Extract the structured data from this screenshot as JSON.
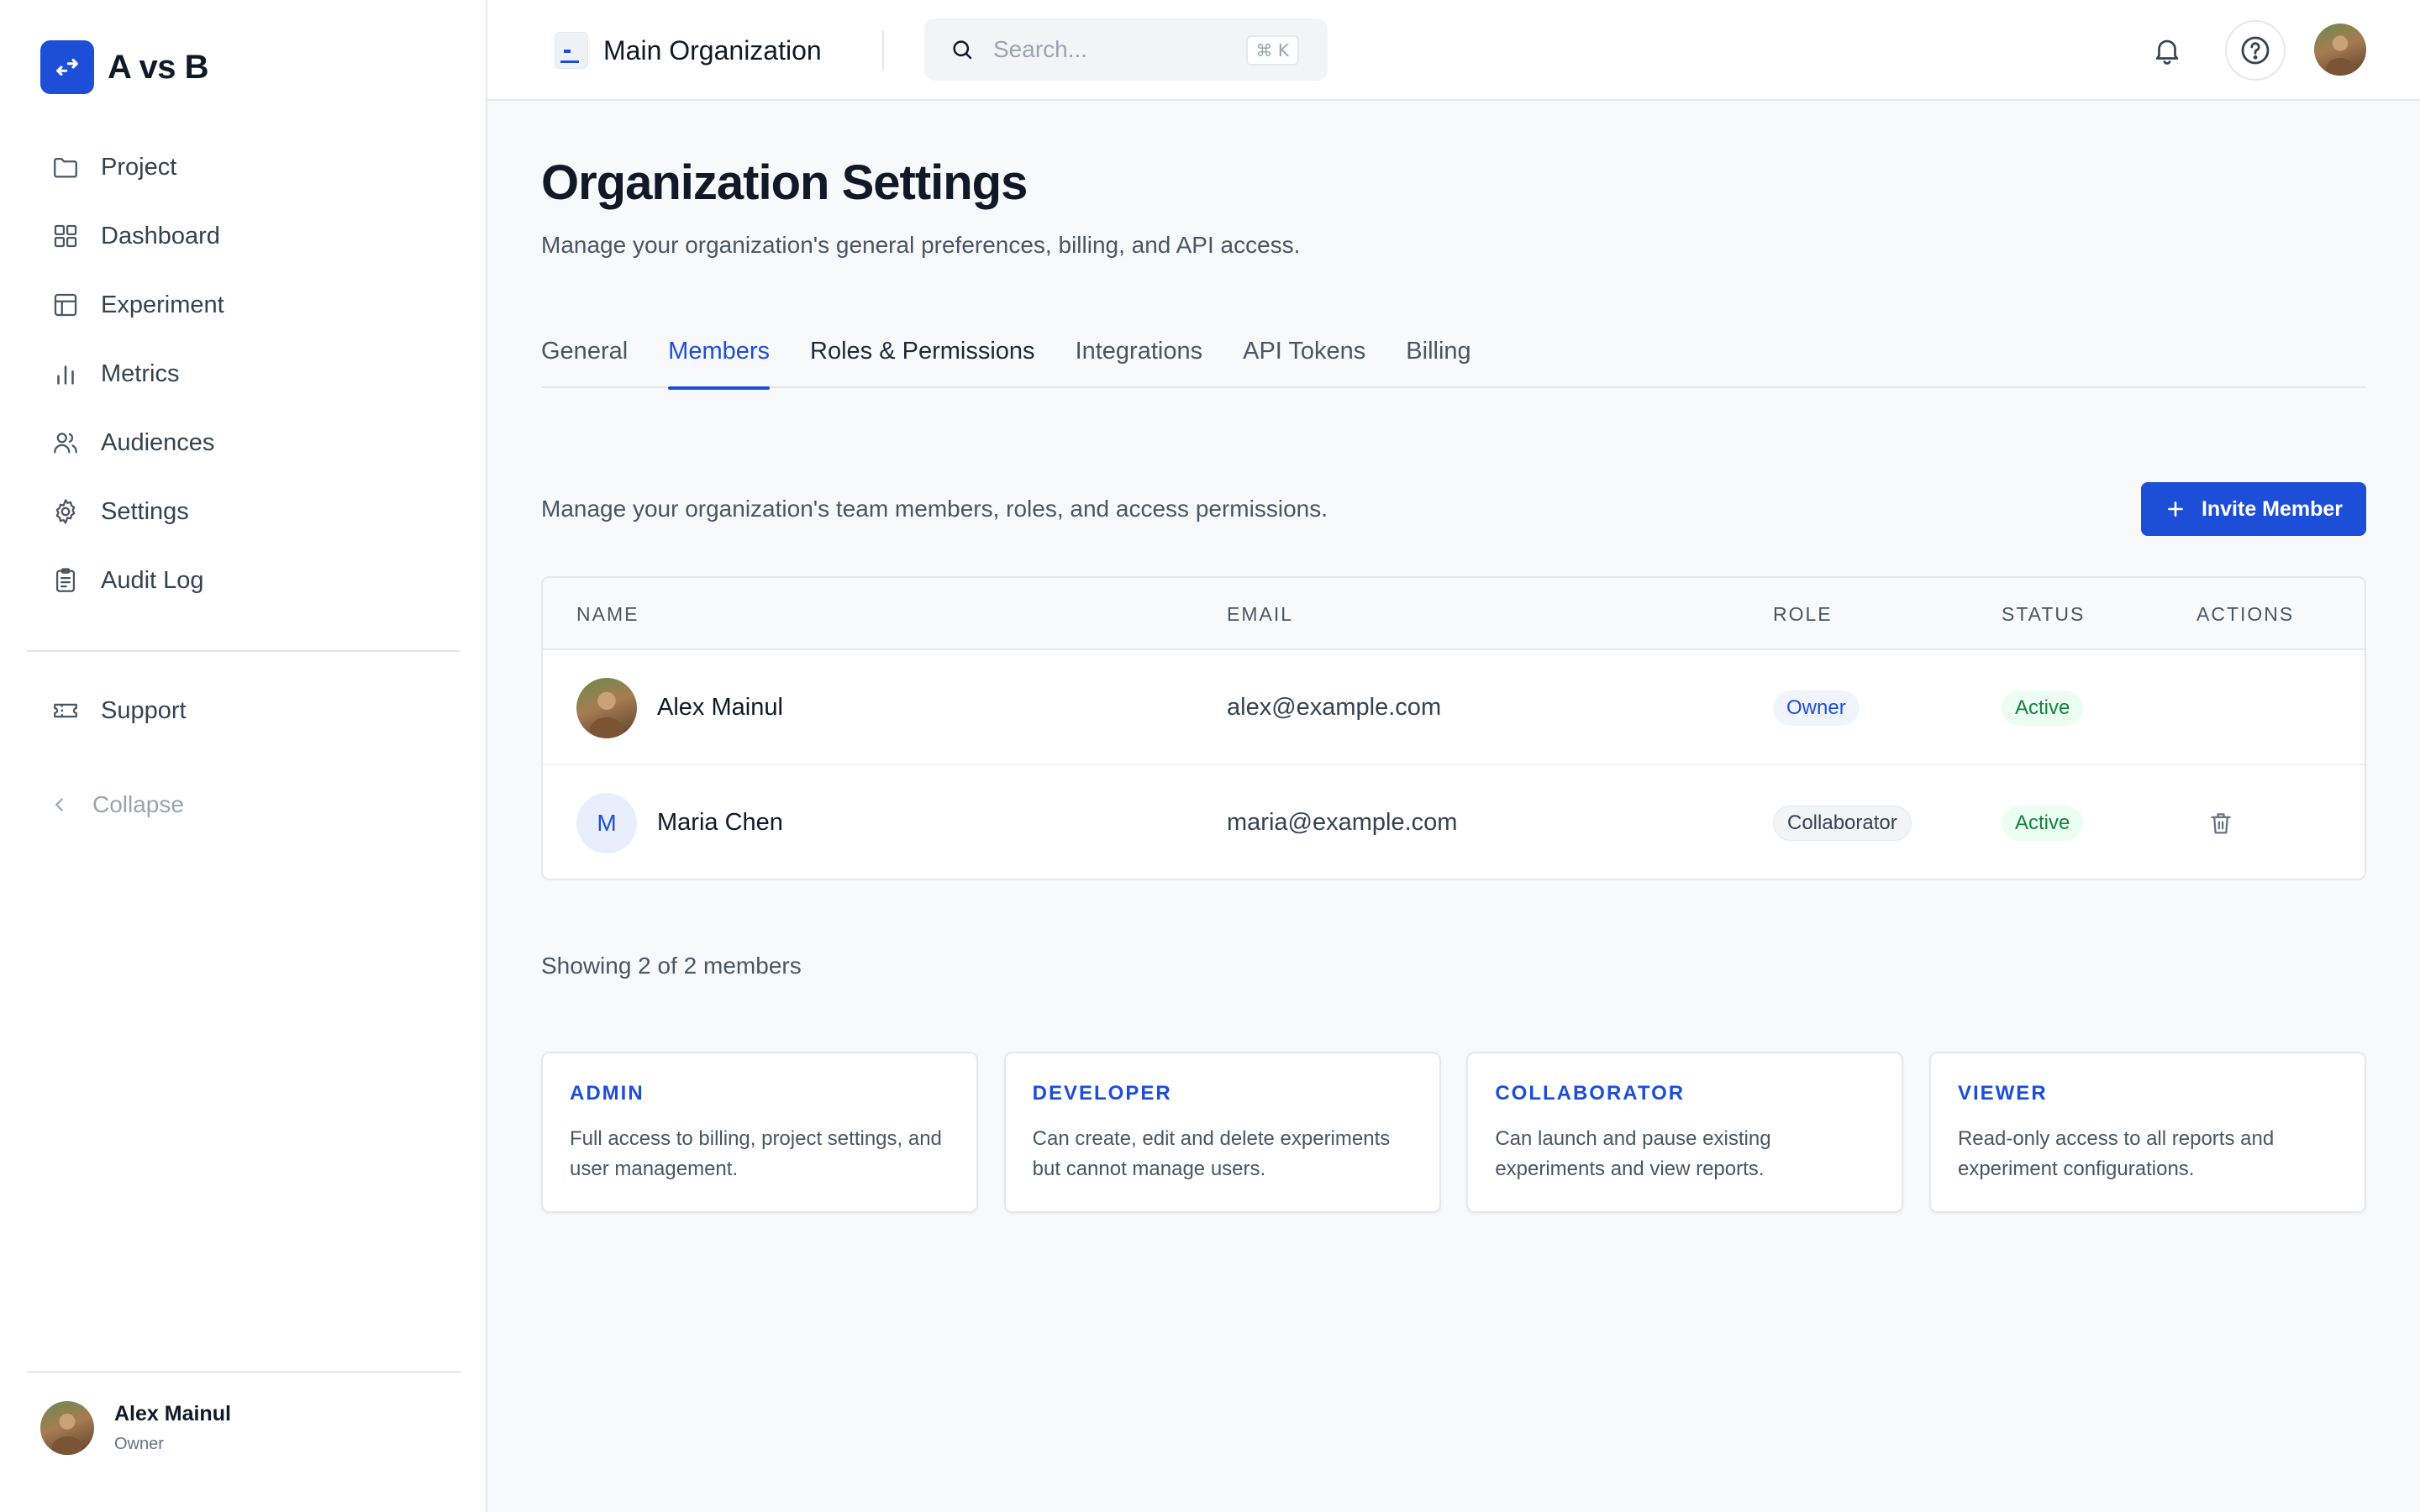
{
  "brand": {
    "name": "A vs B",
    "accent": "#1d4ed8"
  },
  "sidebar": {
    "items": [
      {
        "label": "Project",
        "icon": "folder-icon"
      },
      {
        "label": "Dashboard",
        "icon": "grid-icon"
      },
      {
        "label": "Experiment",
        "icon": "table-icon"
      },
      {
        "label": "Metrics",
        "icon": "bar-chart-icon"
      },
      {
        "label": "Audiences",
        "icon": "users-icon"
      },
      {
        "label": "Settings",
        "icon": "gear-icon"
      },
      {
        "label": "Audit Log",
        "icon": "clipboard-icon"
      }
    ],
    "support_label": "Support",
    "collapse_label": "Collapse",
    "user": {
      "name": "Alex Mainul",
      "role": "Owner"
    }
  },
  "topbar": {
    "org_name": "Main Organization",
    "search_placeholder": "Search...",
    "search_shortcut": "⌘ K"
  },
  "page": {
    "title": "Organization Settings",
    "subtitle": "Manage your organization's general preferences, billing, and API access."
  },
  "tabs": [
    {
      "label": "General"
    },
    {
      "label": "Members",
      "active": true
    },
    {
      "label": "Roles & Permissions"
    },
    {
      "label": "Integrations"
    },
    {
      "label": "API Tokens"
    },
    {
      "label": "Billing"
    }
  ],
  "members": {
    "description": "Manage your organization's team members, roles, and access permissions.",
    "invite_label": "Invite Member",
    "columns": [
      "NAME",
      "EMAIL",
      "ROLE",
      "STATUS",
      "ACTIONS"
    ],
    "rows": [
      {
        "name": "Alex Mainul",
        "initial": "",
        "email": "alex@example.com",
        "role": "Owner",
        "status": "Active"
      },
      {
        "name": "Maria Chen",
        "initial": "M",
        "email": "maria@example.com",
        "role": "Collaborator",
        "status": "Active"
      }
    ],
    "showing": "Showing 2 of 2 members"
  },
  "roles": [
    {
      "title": "ADMIN",
      "desc": "Full access to billing, project settings, and user management."
    },
    {
      "title": "DEVELOPER",
      "desc": "Can create, edit and delete experiments but cannot manage users."
    },
    {
      "title": "COLLABORATOR",
      "desc": "Can launch and pause existing experiments and view reports."
    },
    {
      "title": "VIEWER",
      "desc": "Read-only access to all reports and experiment configurations."
    }
  ]
}
